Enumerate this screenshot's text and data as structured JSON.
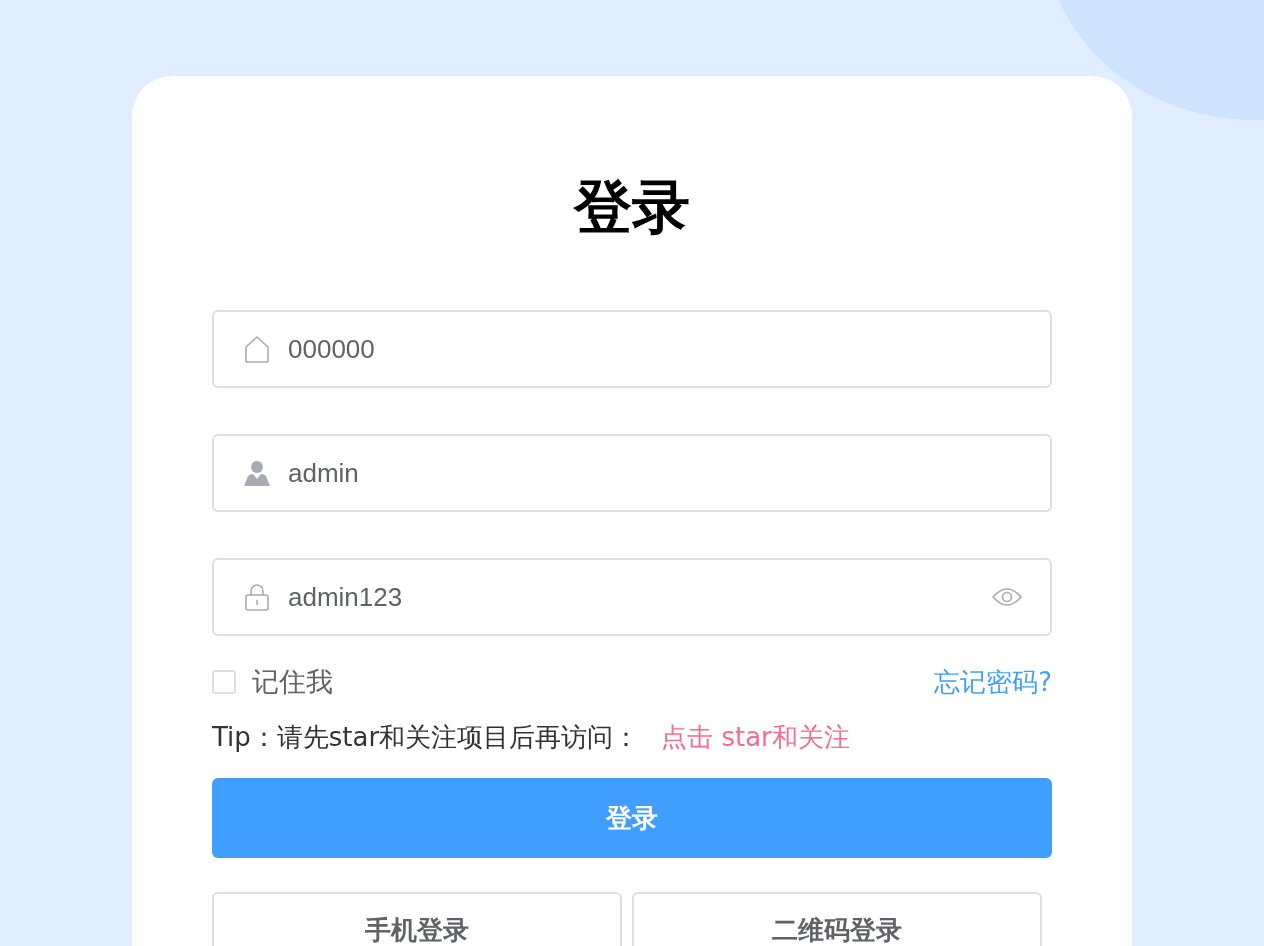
{
  "title": "登录",
  "fields": [
    {
      "kind": "tenant",
      "value": "000000"
    },
    {
      "kind": "username",
      "value": "admin"
    },
    {
      "kind": "password",
      "value": "admin123"
    }
  ],
  "remember": {
    "label": "记住我",
    "checked": false
  },
  "forgot_link": "忘记密码?",
  "tip": {
    "text": "Tip：请先star和关注项目后再访问：",
    "link": "点击 star和关注"
  },
  "login_button": "登录",
  "alt_logins": [
    "手机登录",
    "二维码登录"
  ]
}
